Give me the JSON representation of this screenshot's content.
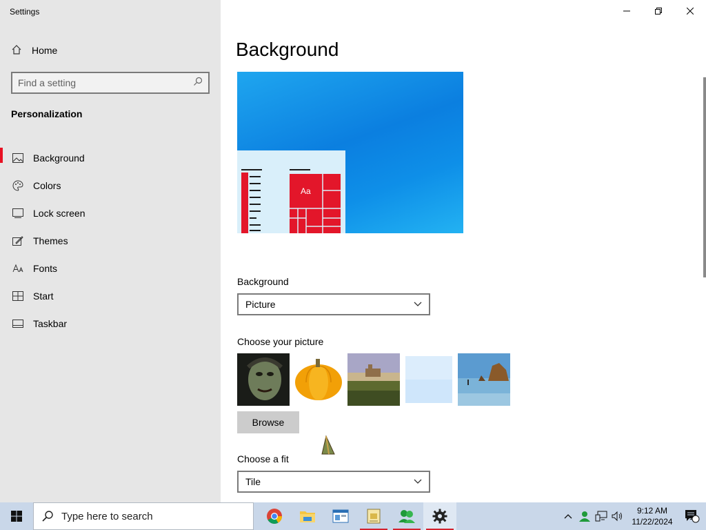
{
  "window": {
    "app_title": "Settings"
  },
  "sidebar": {
    "home_label": "Home",
    "search_placeholder": "Find a setting",
    "section_title": "Personalization",
    "items": [
      {
        "label": "Background",
        "icon": "picture-icon",
        "active": true
      },
      {
        "label": "Colors",
        "icon": "palette-icon",
        "active": false
      },
      {
        "label": "Lock screen",
        "icon": "lock-screen-icon",
        "active": false
      },
      {
        "label": "Themes",
        "icon": "themes-icon",
        "active": false
      },
      {
        "label": "Fonts",
        "icon": "fonts-icon",
        "active": false
      },
      {
        "label": "Start",
        "icon": "start-icon",
        "active": false
      },
      {
        "label": "Taskbar",
        "icon": "taskbar-icon",
        "active": false
      }
    ]
  },
  "main": {
    "page_title": "Background",
    "preview_tile_text": "Aa",
    "background_label": "Background",
    "background_value": "Picture",
    "choose_picture_label": "Choose your picture",
    "browse_label": "Browse",
    "fit_label": "Choose a fit",
    "fit_value": "Tile"
  },
  "taskbar": {
    "search_placeholder": "Type here to search",
    "apps": [
      "chrome-icon",
      "file-explorer-icon",
      "window-app-icon",
      "notepad-icon",
      "people-icon",
      "settings-icon"
    ],
    "clock_time": "9:12 AM",
    "clock_date": "11/22/2024",
    "notification_count": "1"
  },
  "colors": {
    "accent": "#e81123",
    "sidebar_bg": "#e6e6e6",
    "taskbar_bg": "#c9d7e9",
    "preview_blue": "#0b7fe0",
    "tile_red": "#e3162a"
  }
}
